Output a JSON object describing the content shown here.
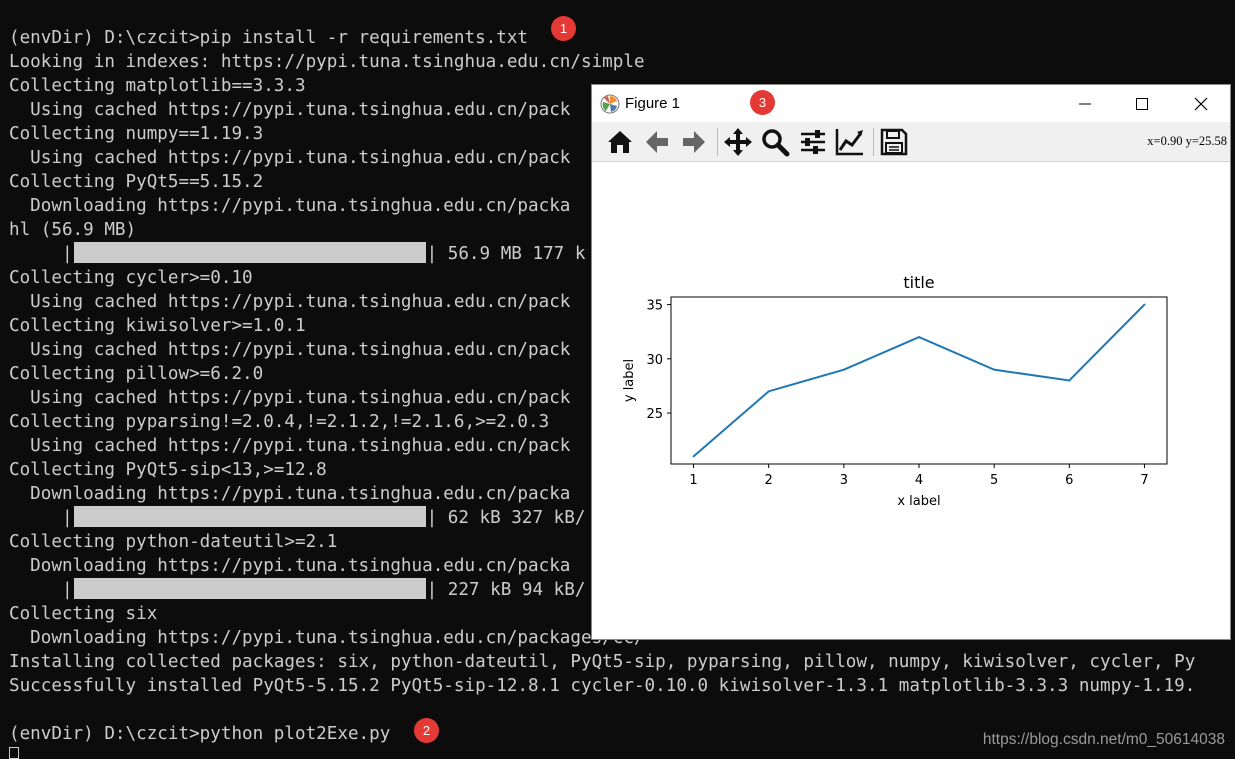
{
  "terminal": {
    "lines": [
      "(envDir) D:\\czcit>pip install -r requirements.txt",
      "Looking in indexes: https://pypi.tuna.tsinghua.edu.cn/simple",
      "Collecting matplotlib==3.3.3",
      "  Using cached https://pypi.tuna.tsinghua.edu.cn/pack",
      "Collecting numpy==1.19.3",
      "  Using cached https://pypi.tuna.tsinghua.edu.cn/pack",
      "Collecting PyQt5==5.15.2",
      "  Downloading https://pypi.tuna.tsinghua.edu.cn/packa",
      "hl (56.9 MB)",
      "     |",
      "Collecting cycler>=0.10",
      "  Using cached https://pypi.tuna.tsinghua.edu.cn/pack",
      "Collecting kiwisolver>=1.0.1",
      "  Using cached https://pypi.tuna.tsinghua.edu.cn/pack",
      "Collecting pillow>=6.2.0",
      "  Using cached https://pypi.tuna.tsinghua.edu.cn/pack",
      "Collecting pyparsing!=2.0.4,!=2.1.2,!=2.1.6,>=2.0.3",
      "  Using cached https://pypi.tuna.tsinghua.edu.cn/pack",
      "Collecting PyQt5-sip<13,>=12.8",
      "  Downloading https://pypi.tuna.tsinghua.edu.cn/packa",
      "     |",
      "Collecting python-dateutil>=2.1",
      "  Downloading https://pypi.tuna.tsinghua.edu.cn/packa",
      "     |",
      "Collecting six",
      "  Downloading https://pypi.tuna.tsinghua.edu.cn/packages/cc/",
      "Installing collected packages: six, python-dateutil, PyQt5-sip, pyparsing, pillow, numpy, kiwisolver, cycler, Py",
      "Successfully installed PyQt5-5.15.2 PyQt5-sip-12.8.1 cycler-0.10.0 kiwisolver-1.3.1 matplotlib-3.3.3 numpy-1.19.",
      "",
      "(envDir) D:\\czcit>python plot2Exe.py"
    ],
    "progress": [
      {
        "line": 9,
        "fraction": 1.0,
        "text": "| 56.9 MB 177 k"
      },
      {
        "line": 20,
        "fraction": 1.0,
        "text": "| 62 kB 327 kB/"
      },
      {
        "line": 23,
        "fraction": 1.0,
        "text": "| 227 kB 94 kB/"
      }
    ],
    "badges": [
      "1",
      "2",
      "3"
    ]
  },
  "window": {
    "title": "Figure 1",
    "coord_readout": "x=0.90 y=25.58",
    "toolbar": [
      "home-icon",
      "back-arrow-icon",
      "forward-arrow-icon",
      "pan-move-icon",
      "zoom-magnifier-icon",
      "configure-subplots-icon",
      "edit-axis-icon",
      "save-icon"
    ]
  },
  "chart_data": {
    "type": "line",
    "title": "title",
    "xlabel": "x label",
    "ylabel": "y label",
    "x": [
      1,
      2,
      3,
      4,
      5,
      6,
      7
    ],
    "series": [
      {
        "values": [
          21,
          27,
          29,
          32,
          29,
          28,
          35
        ],
        "color": "#1f77b4"
      }
    ],
    "xticks": [
      "1",
      "2",
      "3",
      "4",
      "5",
      "6",
      "7"
    ],
    "yticks": [
      25,
      30,
      35
    ],
    "xlim": [
      0.7,
      7.3
    ],
    "ylim": [
      20.3,
      35.7
    ],
    "grid": false
  },
  "watermark": "https://blog.csdn.net/m0_50614038"
}
